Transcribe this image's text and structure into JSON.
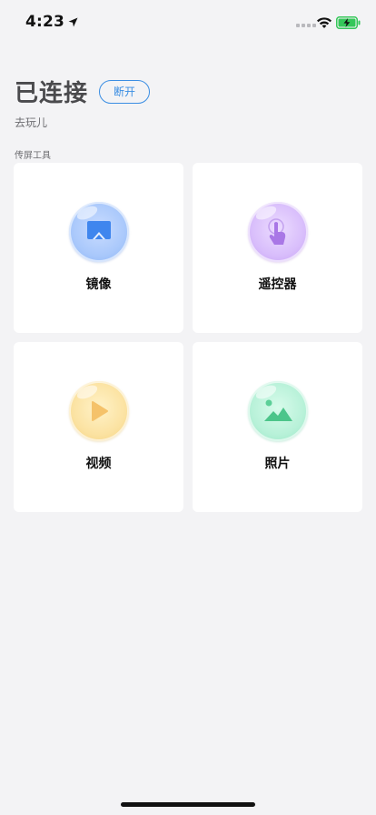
{
  "status_bar": {
    "time": "4:23",
    "location_icon": "location-arrow-icon",
    "wifi_icon": "wifi-icon",
    "battery_icon": "battery-charging-icon",
    "battery_color": "#34c759"
  },
  "header": {
    "title": "已连接",
    "disconnect_label": "断开",
    "subtitle": "去玩儿",
    "accent_color": "#3b8ee3"
  },
  "section": {
    "label": "传屏工具"
  },
  "tiles": [
    {
      "label": "镜像",
      "icon": "screen-mirror-icon",
      "color": "#a9c8fb"
    },
    {
      "label": "遥控器",
      "icon": "remote-control-touch-icon",
      "color": "#d8bdfb"
    },
    {
      "label": "视频",
      "icon": "video-play-icon",
      "color": "#fbe2a1"
    },
    {
      "label": "照片",
      "icon": "photo-icon",
      "color": "#b7f1d8"
    }
  ]
}
